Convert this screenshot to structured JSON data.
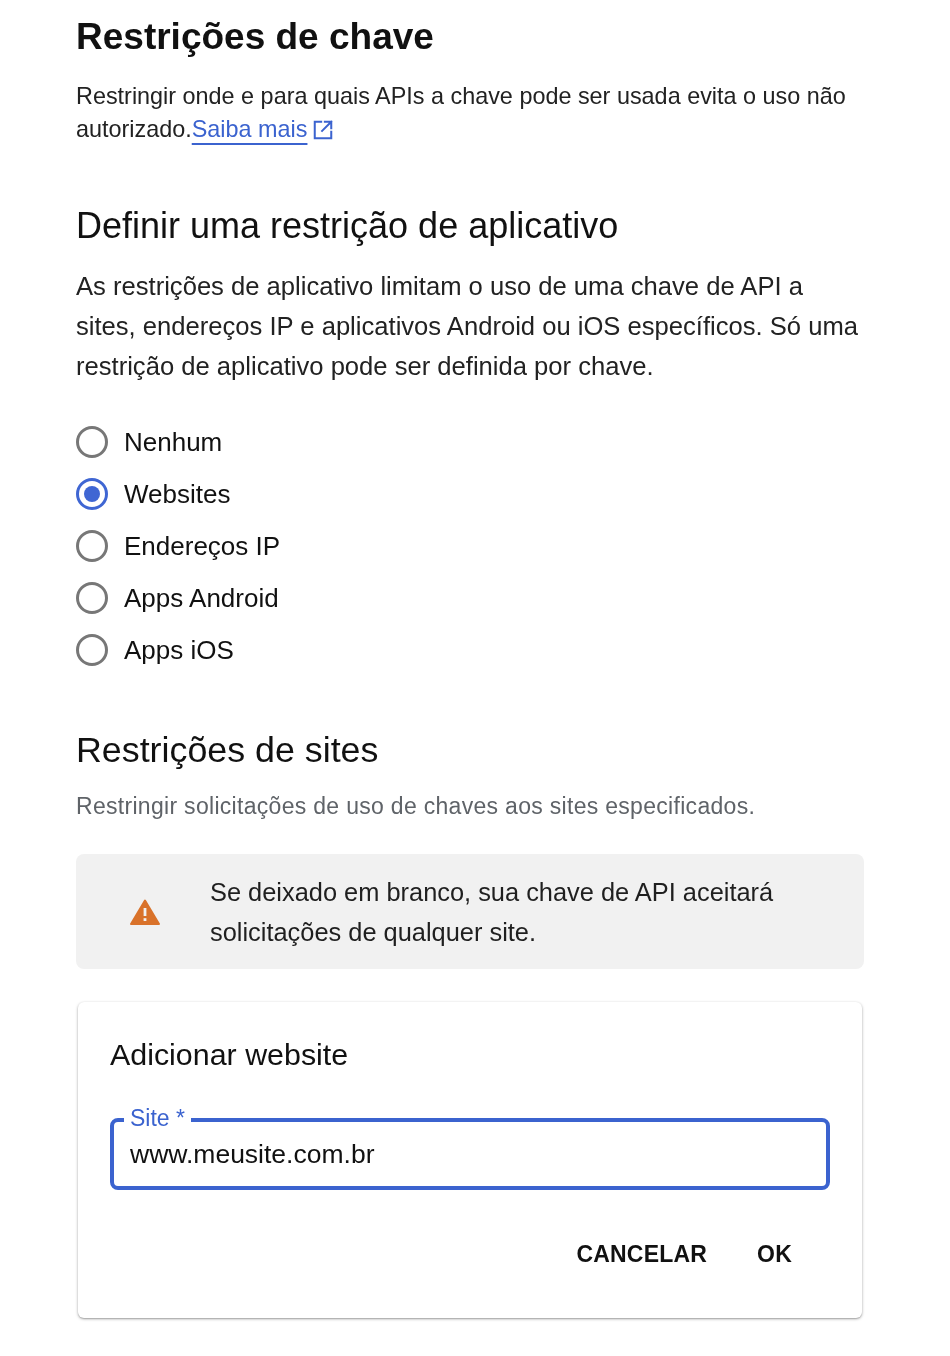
{
  "key_restrictions": {
    "title": "Restrições de chave",
    "intro": "Restringir onde e para quais APIs a chave pode ser usada evita o uso não autorizado.",
    "learn_more_link": "Saiba mais"
  },
  "application_restriction": {
    "heading": "Definir uma restrição de aplicativo",
    "description": "As restrições de aplicativo limitam o uso de uma chave de API a sites, endereços IP e aplicativos Android ou iOS específicos. Só uma restrição de aplicativo pode ser definida por chave.",
    "options": [
      {
        "label": "Nenhum",
        "selected": false
      },
      {
        "label": "Websites",
        "selected": true
      },
      {
        "label": "Endereços IP",
        "selected": false
      },
      {
        "label": "Apps Android",
        "selected": false
      },
      {
        "label": "Apps iOS",
        "selected": false
      }
    ]
  },
  "site_restrictions": {
    "heading": "Restrições de sites",
    "description": "Restringir solicitações de uso de chaves aos sites especificados.",
    "warning": "Se deixado em branco, sua chave de API aceitará solicitações de qualquer site."
  },
  "add_website_dialog": {
    "title": "Adicionar website",
    "field": {
      "label": "Site *",
      "value": "www.meusite.com.br",
      "focused": true
    },
    "buttons": [
      "CANCELAR",
      "OK"
    ]
  }
}
